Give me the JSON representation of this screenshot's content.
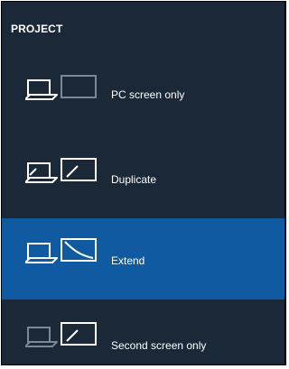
{
  "panel": {
    "title": "PROJECT",
    "items": [
      {
        "label": "PC screen only",
        "icon": "pc-screen-only-icon",
        "selected": false
      },
      {
        "label": "Duplicate",
        "icon": "duplicate-icon",
        "selected": false
      },
      {
        "label": "Extend",
        "icon": "extend-icon",
        "selected": true
      },
      {
        "label": "Second screen only",
        "icon": "second-screen-only-icon",
        "selected": false
      }
    ]
  },
  "colors": {
    "background": "#1a2838",
    "selected": "#0f5aa0",
    "text": "#ffffff",
    "dim_icon": "#7d8894"
  }
}
